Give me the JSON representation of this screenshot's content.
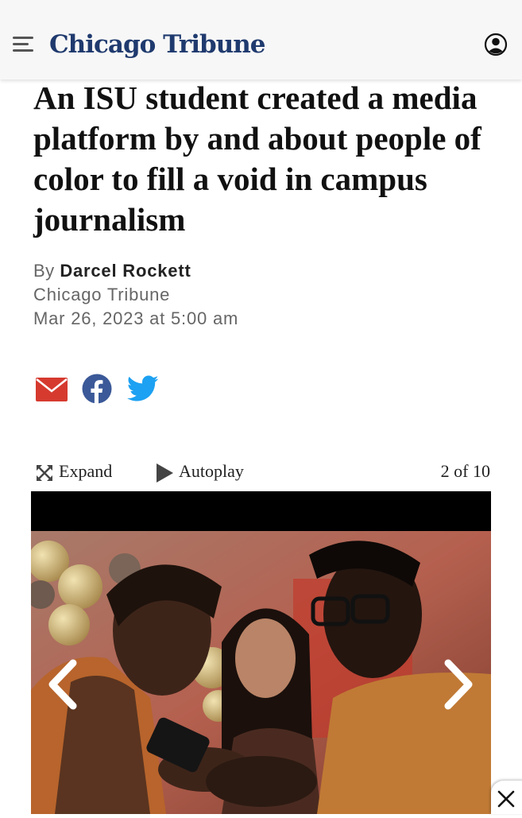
{
  "header": {
    "logo_text": "Chicago Tribune",
    "menu_icon": "hamburger-menu-icon",
    "account_icon": "user-account-icon",
    "brand_color": "#1f3a6e"
  },
  "article": {
    "headline": "An ISU student created a media platform by and about people of color to fill a void in campus journalism",
    "byline_prefix": "By",
    "author": "Darcel Rockett",
    "source": "Chicago Tribune",
    "date": "Mar 26, 2023 at 5:00 am"
  },
  "share": {
    "email_icon": "email-icon",
    "facebook_icon": "facebook-icon",
    "twitter_icon": "twitter-icon",
    "email_color": "#d63a2f",
    "facebook_color": "#3b5998",
    "twitter_color": "#1da1f2"
  },
  "gallery": {
    "expand_label": "Expand",
    "autoplay_label": "Autoplay",
    "counter": "2 of 10",
    "prev_icon": "chevron-left-icon",
    "next_icon": "chevron-right-icon"
  },
  "overlay": {
    "close_icon": "close-icon"
  }
}
